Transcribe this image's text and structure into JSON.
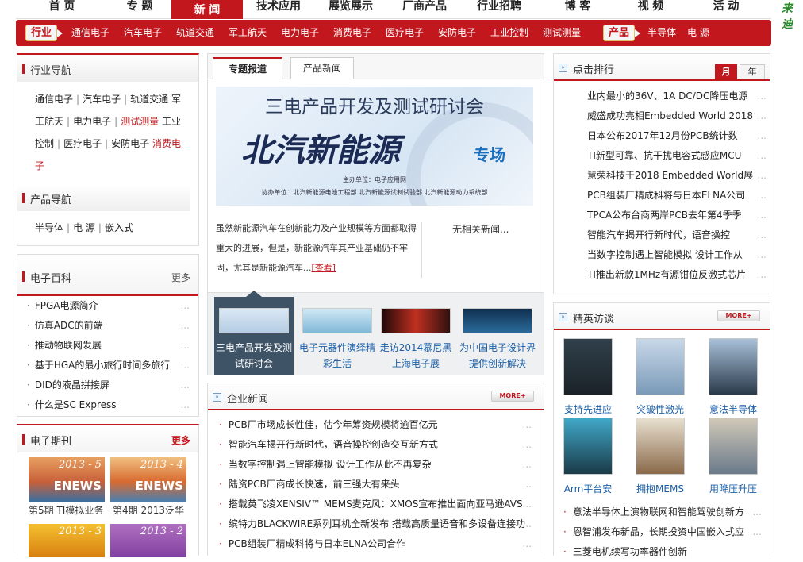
{
  "topnav": [
    "首 页",
    "专 题",
    "新 闻",
    "技术应用",
    "展览展示",
    "厂商产品",
    "行业招聘",
    "博 客",
    "视 频",
    "活 动"
  ],
  "logo_text": "来迪",
  "subnav": {
    "industry_tag": "行业",
    "industry": [
      "通信电子",
      "汽车电子",
      "轨道交通",
      "军工航天",
      "电力电子",
      "消费电子",
      "医疗电子",
      "安防电子",
      "工业控制",
      "测试测量"
    ],
    "product_tag": "产品",
    "products": [
      "半导体",
      "电 源"
    ]
  },
  "industry_nav": {
    "title": "行业导航",
    "items": [
      "通信电子",
      "汽车电子",
      "轨道交通",
      "军工航天",
      "电力电子",
      "测试测量",
      "工业控制",
      "医疗电子",
      "安防电子",
      "消费电子"
    ],
    "product_title": "产品导航",
    "products": [
      "半导体",
      "电 源",
      "嵌入式"
    ]
  },
  "encyclopedia": {
    "title": "电子百科",
    "more": "更多",
    "items": [
      "FPGA电源简介",
      "仿真ADC的前端",
      "推动物联网发展",
      "基于HGA的最小旅行时间多旅行",
      "DID的液晶拼接屏",
      "什么是SC Express"
    ]
  },
  "periodicals": {
    "title": "电子期刊",
    "more": "更多",
    "items": [
      {
        "cover": "2013 - 5",
        "brand": "ENEWS",
        "caption": "第5期 TI模拟业务"
      },
      {
        "cover": "2013 - 4",
        "brand": "ENEWS",
        "caption": "第4期 2013泛华"
      },
      {
        "cover": "2013 - 3",
        "brand": "",
        "caption": ""
      },
      {
        "cover": "2013 - 2",
        "brand": "",
        "caption": ""
      }
    ]
  },
  "feature": {
    "tabs": [
      "专题报道",
      "产品新闻"
    ],
    "banner": {
      "line1": "三电产品开发及测试研讨会",
      "line2": "北汽新能源",
      "tag": "专场",
      "host": "主办单位：电子应用网",
      "co": "协办单位：北汽新能源电池工程部  北汽新能源试制试验部  北汽新能源动力系统部"
    },
    "summary": "虽然新能源汽车在创新能力及产业规模等方面都取得重大的进展，但是，新能源汽车其产业基础仍不牢固，尤其是新能源汽车...",
    "view_link": "[查看]",
    "related": "无相关新闻...",
    "thumbs": [
      {
        "caption": "三电产品开发及测试研讨会"
      },
      {
        "caption": "电子元器件演绎精彩生活"
      },
      {
        "caption": "走访2014慕尼黑上海电子展"
      },
      {
        "caption": "为中国电子设计界提供创新解决"
      }
    ]
  },
  "company_news": {
    "title": "企业新闻",
    "more": "MORE+",
    "items": [
      "PCB厂市场成长性佳，估今年筹资规模将逾百亿元",
      "智能汽车揭开行新时代，语音操控创造交互新方式",
      "当数字控制遇上智能模拟 设计工作从此不再复杂",
      "陆资PCB厂商成长快速，前三强大有来头",
      "搭载英飞凌XENSIV™ MEMS麦克风：XMOS宣布推出面向亚马逊AVS",
      "缤特力BLACKWIRE系列耳机全新发布 搭载高质量语音和多设备连接功",
      "PCB组装厂精成科将与日本ELNA公司合作"
    ]
  },
  "ranking": {
    "title": "点击排行",
    "tabs": [
      "月",
      "年"
    ],
    "items": [
      "业内最小的36V、1A DC/DC降压电源",
      "威盛成功亮相Embedded World 2018",
      "日本公布2017年12月份PCB统计数",
      "TI新型可靠、抗干扰电容式感应MCU",
      "慧荣科技于2018 Embedded World展",
      "PCB组装厂精成科将与日本ELNA公司",
      "TPCA公布台商两岸PCB去年第4季季",
      "智能汽车揭开行新时代，语音操控",
      "当数字控制遇上智能模拟 设计工作从",
      "TI推出新款1MHz有源钳位反激式芯片"
    ]
  },
  "elite": {
    "title": "精英访谈",
    "more": "MORE+",
    "people": [
      "支持先进应",
      "突破性激光",
      "意法半导体",
      "Arm平台安",
      "拥抱MEMS",
      "用降压升压"
    ],
    "news": [
      "意法半导体上演物联网和智能驾驶创新方",
      "恩智浦发布新品，长期投资中国嵌入式应",
      "三菱电机续写功率器件创新"
    ]
  }
}
